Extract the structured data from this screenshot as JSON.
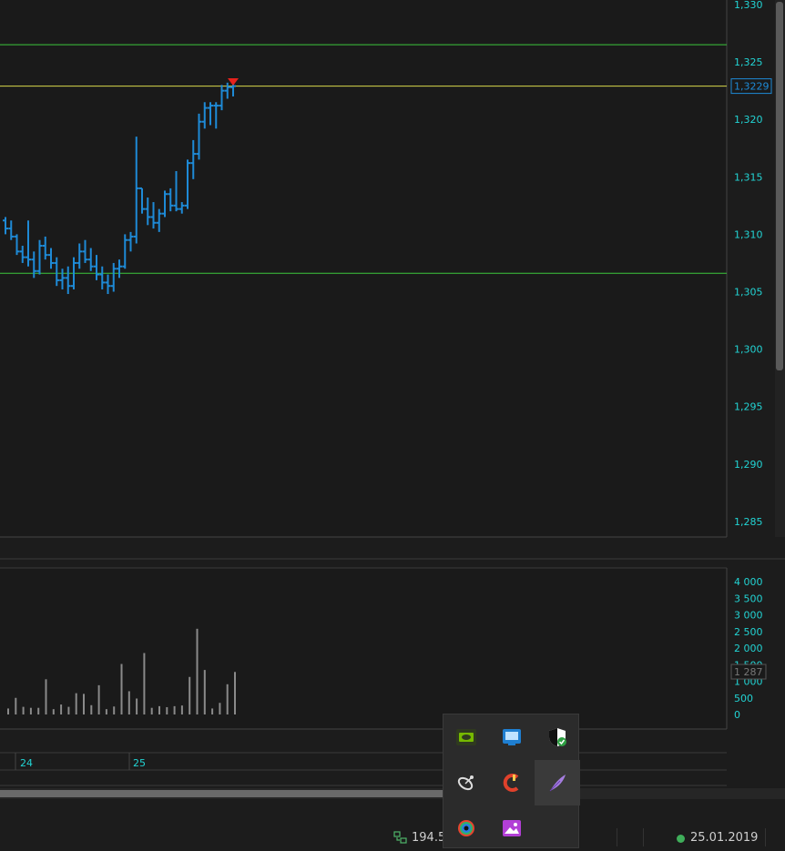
{
  "chart_data": [
    {
      "type": "ohlc",
      "panel": "price",
      "ylim": [
        1.284,
        1.331
      ],
      "y_ticks": [
        "1,330",
        "1,325",
        "1,320",
        "1,315",
        "1,310",
        "1,305",
        "1,300",
        "1,295",
        "1,290",
        "1,285"
      ],
      "y_tick_values": [
        1.33,
        1.325,
        1.32,
        1.315,
        1.31,
        1.305,
        1.3,
        1.295,
        1.29,
        1.285
      ],
      "current_price_label": "1,3229",
      "current_price": 1.3229,
      "horizontal_lines": [
        {
          "value": 1.3265,
          "color": "#3cc83c"
        },
        {
          "value": 1.3229,
          "color": "#d8d84a"
        },
        {
          "value": 1.3066,
          "color": "#3cc83c"
        }
      ],
      "bars": [
        [
          1.3112,
          1.3115,
          1.31,
          1.3105
        ],
        [
          1.3105,
          1.3112,
          1.3095,
          1.3098
        ],
        [
          1.3098,
          1.31,
          1.3082,
          1.3085
        ],
        [
          1.3085,
          1.309,
          1.3075,
          1.308
        ],
        [
          1.308,
          1.3112,
          1.3072,
          1.3078
        ],
        [
          1.3078,
          1.3085,
          1.3062,
          1.3068
        ],
        [
          1.3068,
          1.3095,
          1.3065,
          1.309
        ],
        [
          1.309,
          1.3098,
          1.3078,
          1.3082
        ],
        [
          1.3082,
          1.3088,
          1.307,
          1.3075
        ],
        [
          1.3075,
          1.308,
          1.3055,
          1.306
        ],
        [
          1.306,
          1.307,
          1.3052,
          1.3062
        ],
        [
          1.3062,
          1.3072,
          1.3048,
          1.3055
        ],
        [
          1.3055,
          1.308,
          1.3052,
          1.3075
        ],
        [
          1.3075,
          1.3092,
          1.307,
          1.3085
        ],
        [
          1.3085,
          1.3095,
          1.3075,
          1.3078
        ],
        [
          1.3078,
          1.3088,
          1.3068,
          1.3072
        ],
        [
          1.3072,
          1.3082,
          1.306,
          1.3065
        ],
        [
          1.3065,
          1.3072,
          1.3052,
          1.3058
        ],
        [
          1.3058,
          1.3065,
          1.3048,
          1.3055
        ],
        [
          1.3055,
          1.3075,
          1.305,
          1.307
        ],
        [
          1.307,
          1.3078,
          1.3062,
          1.3072
        ],
        [
          1.3072,
          1.31,
          1.307,
          1.3095
        ],
        [
          1.3095,
          1.3102,
          1.3085,
          1.3098
        ],
        [
          1.3098,
          1.3185,
          1.3092,
          1.314
        ],
        [
          1.314,
          1.314,
          1.3118,
          1.3122
        ],
        [
          1.3122,
          1.3132,
          1.3108,
          1.3115
        ],
        [
          1.3115,
          1.3128,
          1.3105,
          1.311
        ],
        [
          1.311,
          1.3122,
          1.3102,
          1.3118
        ],
        [
          1.3118,
          1.3138,
          1.3115,
          1.3135
        ],
        [
          1.3135,
          1.314,
          1.312,
          1.3125
        ],
        [
          1.3125,
          1.3155,
          1.312,
          1.3122
        ],
        [
          1.3122,
          1.3128,
          1.3118,
          1.3125
        ],
        [
          1.3125,
          1.3165,
          1.3122,
          1.3162
        ],
        [
          1.3162,
          1.3182,
          1.3148,
          1.317
        ],
        [
          1.317,
          1.3205,
          1.3165,
          1.3198
        ],
        [
          1.3198,
          1.3215,
          1.3192,
          1.321
        ],
        [
          1.321,
          1.3215,
          1.3195,
          1.3212
        ],
        [
          1.3212,
          1.3215,
          1.3192,
          1.3212
        ],
        [
          1.3212,
          1.323,
          1.3208,
          1.3225
        ],
        [
          1.3225,
          1.3232,
          1.3218,
          1.3228
        ],
        [
          1.3228,
          1.3235,
          1.322,
          1.3229
        ]
      ],
      "down_arrow_marker_at_bar": 40,
      "series_color": "#1e8ad6"
    },
    {
      "type": "bar",
      "panel": "volume",
      "ylim": [
        0,
        4200
      ],
      "y_ticks": [
        "4 000",
        "3 500",
        "3 000",
        "2 500",
        "2 000",
        "1 500",
        "1 000",
        "500",
        "0"
      ],
      "y_tick_values": [
        4000,
        3500,
        3000,
        2500,
        2000,
        1500,
        1000,
        500,
        0
      ],
      "current_volume_label": "1 287",
      "current_volume": 1287,
      "values": [
        180,
        500,
        230,
        200,
        200,
        1060,
        160,
        300,
        230,
        640,
        620,
        280,
        880,
        160,
        240,
        1520,
        700,
        480,
        1850,
        200,
        250,
        220,
        250,
        270,
        1130,
        2580,
        1340,
        180,
        350,
        910,
        1280
      ],
      "bar_color": "#8a8a8a"
    }
  ],
  "x_axis": {
    "labels": [
      "24",
      "25"
    ]
  },
  "tray_icons": [
    {
      "name": "nvidia-icon"
    },
    {
      "name": "intel-graphics-icon"
    },
    {
      "name": "windows-security-icon"
    },
    {
      "name": "satellite-dish-icon"
    },
    {
      "name": "ccleaner-icon"
    },
    {
      "name": "feather-pen-icon"
    },
    {
      "name": "colorful-ring-icon"
    },
    {
      "name": "image-viewer-icon"
    }
  ],
  "status_bar": {
    "connection_value": "194.5",
    "date": "25.01.2019",
    "date_dot_color": "#3fae5a"
  }
}
